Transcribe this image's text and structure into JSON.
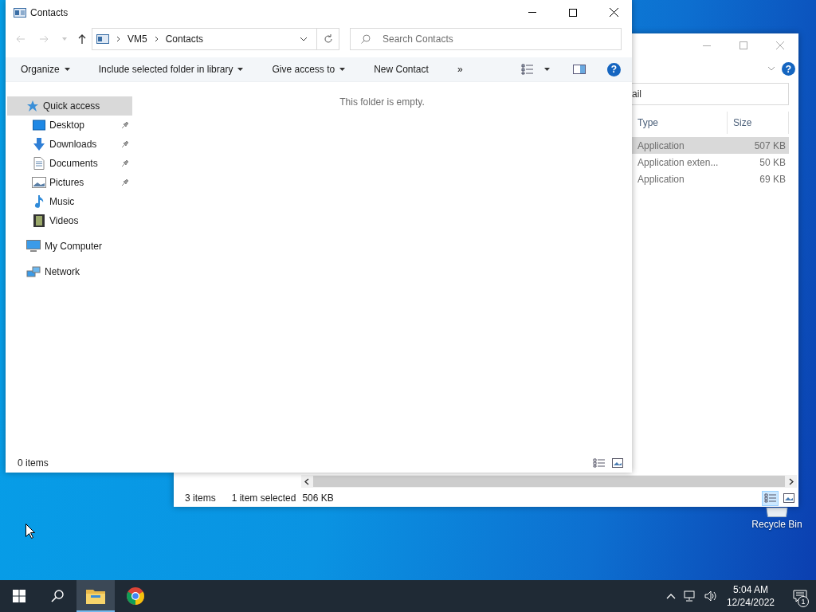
{
  "desktop": {
    "icons": [
      {
        "label": "Recycle Bin"
      }
    ]
  },
  "back_window": {
    "search": {
      "value": "ail"
    },
    "columns": [
      "Type",
      "Size"
    ],
    "rows": [
      {
        "type": "Application",
        "size": "507 KB",
        "selected": true
      },
      {
        "type": "Application exten...",
        "size": "50 KB",
        "selected": false
      },
      {
        "type": "Application",
        "size": "69 KB",
        "selected": false
      }
    ],
    "status": {
      "items": "3 items",
      "selection": "1 item selected",
      "size": "506 KB"
    },
    "help_label": "?",
    "view_buttons": [
      {
        "kind": "details",
        "selected": true
      },
      {
        "kind": "preview",
        "selected": false
      }
    ]
  },
  "front_window": {
    "title": "Contacts",
    "path": [
      "VM5",
      "Contacts"
    ],
    "search": {
      "placeholder": "Search Contacts"
    },
    "toolbar": [
      {
        "label": "Organize",
        "dropdown": true
      },
      {
        "label": "Include selected folder in library",
        "dropdown": true
      },
      {
        "label": "Give access to",
        "dropdown": true
      },
      {
        "label": "New Contact",
        "dropdown": false
      },
      {
        "label": "»",
        "dropdown": false
      }
    ],
    "help_label": "?",
    "sidebar": [
      {
        "label": "Quick access",
        "kind": "star",
        "selected": true,
        "children": [
          {
            "label": "Desktop",
            "kind": "desktop",
            "pinned": true,
            "selected": false
          },
          {
            "label": "Downloads",
            "kind": "download",
            "pinned": true,
            "selected": false
          },
          {
            "label": "Documents",
            "kind": "document",
            "pinned": true,
            "selected": false
          },
          {
            "label": "Pictures",
            "kind": "picture",
            "pinned": true,
            "selected": false
          },
          {
            "label": "Music",
            "kind": "music",
            "pinned": false,
            "selected": false
          },
          {
            "label": "Videos",
            "kind": "video",
            "pinned": false,
            "selected": false
          }
        ]
      },
      {
        "label": "My Computer",
        "kind": "computer",
        "selected": false
      },
      {
        "label": "Network",
        "kind": "network",
        "selected": false
      }
    ],
    "empty_message": "This folder is empty.",
    "status": "0 items",
    "view_buttons": [
      {
        "kind": "details",
        "selected": false
      },
      {
        "kind": "preview",
        "selected": false
      }
    ]
  },
  "taskbar": {
    "apps": [
      {
        "kind": "explorer",
        "active": true
      },
      {
        "kind": "chrome",
        "active": false
      }
    ],
    "time": "5:04 AM",
    "date": "12/24/2022",
    "notifications": "1"
  }
}
